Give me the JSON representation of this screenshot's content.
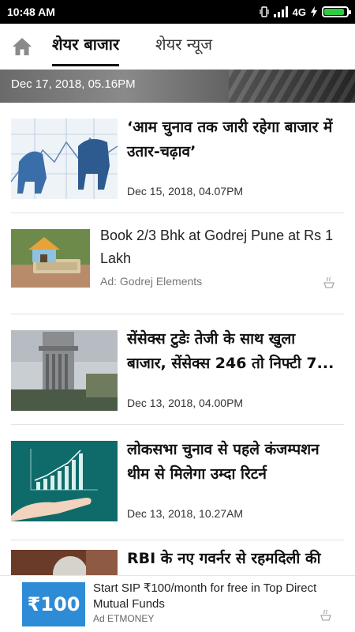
{
  "status_bar": {
    "time": "10:48 AM",
    "network": "4G",
    "battery_level": 0.9
  },
  "tabs": [
    {
      "label": "शेयर बाजार",
      "active": true
    },
    {
      "label": "शेयर न्यूज",
      "active": false
    }
  ],
  "hero": {
    "date": "Dec 17, 2018, 05.16PM"
  },
  "feed": {
    "item1": {
      "headline": "‘आम चुनाव तक जारी रहेगा बाजार में उतार-चढ़ाव’",
      "date": "Dec 15, 2018, 04.07PM",
      "thumb_icon": "bull-bear-icon"
    },
    "ad1": {
      "title": "Book 2/3 Bhk at Godrej Pune at Rs 1 Lakh",
      "label": "Ad: Godrej Elements",
      "thumb_icon": "house-money-icon"
    },
    "item2": {
      "line1": "सेंसेक्स टुडेः तेजी के साथ खुला",
      "line2": "बाजार, सेंसेक्स 246 तो निफ्टी 7...",
      "date": "Dec 13, 2018, 04.00PM",
      "thumb_icon": "stock-exchange-building-icon"
    },
    "item3": {
      "headline": "लोकसभा चुनाव से पहले कंजम्पशन थीम से मिलेगा उम्दा रिटर्न",
      "date": "Dec 13, 2018, 10.27AM",
      "thumb_icon": "growth-chart-hand-icon"
    },
    "item4": {
      "headline": "RBI के नए गवर्नर से रहमदिली की",
      "thumb_icon": "person-photo-icon"
    }
  },
  "bottom_ad": {
    "badge": "₹100",
    "title": "Start SIP ₹100/month for free in Top Direct Mutual Funds",
    "label": "Ad ETMONEY"
  },
  "colors": {
    "accent_green": "#2ecc40",
    "ad_blue": "#2e8bd6"
  }
}
